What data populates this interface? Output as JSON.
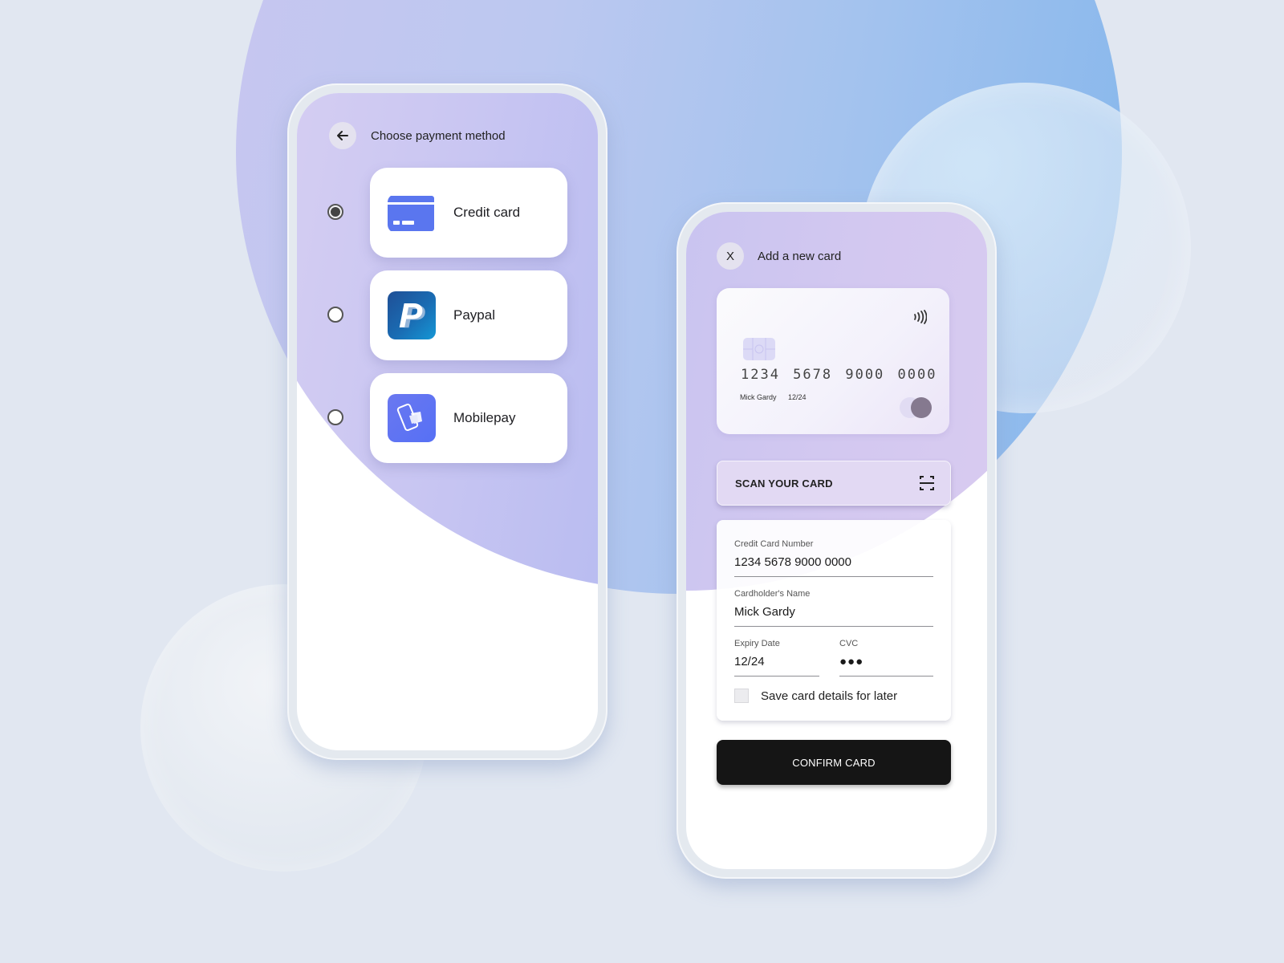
{
  "payment_screen": {
    "title": "Choose payment method",
    "back_icon": "arrow-left-icon",
    "options": [
      {
        "label": "Credit card",
        "icon": "credit-card-icon",
        "selected": true
      },
      {
        "label": "Paypal",
        "icon": "paypal-logo-icon",
        "selected": false
      },
      {
        "label": "Mobilepay",
        "icon": "mobilepay-logo-icon",
        "selected": false
      }
    ]
  },
  "add_card_screen": {
    "title": "Add a new card",
    "close_label": "X",
    "card_preview": {
      "number": "1234 5678 9000 0000",
      "holder": "Mick Gardy",
      "expiry": "12/24",
      "contactless_icon": "contactless-icon",
      "network_icon": "mastercard-logo-icon"
    },
    "scan_button": {
      "label": "SCAN YOUR CARD",
      "icon": "scan-icon"
    },
    "form": {
      "card_number": {
        "label": "Credit Card Number",
        "value": "1234 5678 9000 0000"
      },
      "cardholder": {
        "label": "Cardholder's Name",
        "value": "Mick Gardy"
      },
      "expiry": {
        "label": "Expiry Date",
        "value": "12/24"
      },
      "cvc": {
        "label": "CVC",
        "value": "●●●"
      },
      "save_details": {
        "label": "Save card details for later",
        "checked": false
      }
    },
    "confirm_button": {
      "label": "CONFIRM CARD"
    }
  }
}
